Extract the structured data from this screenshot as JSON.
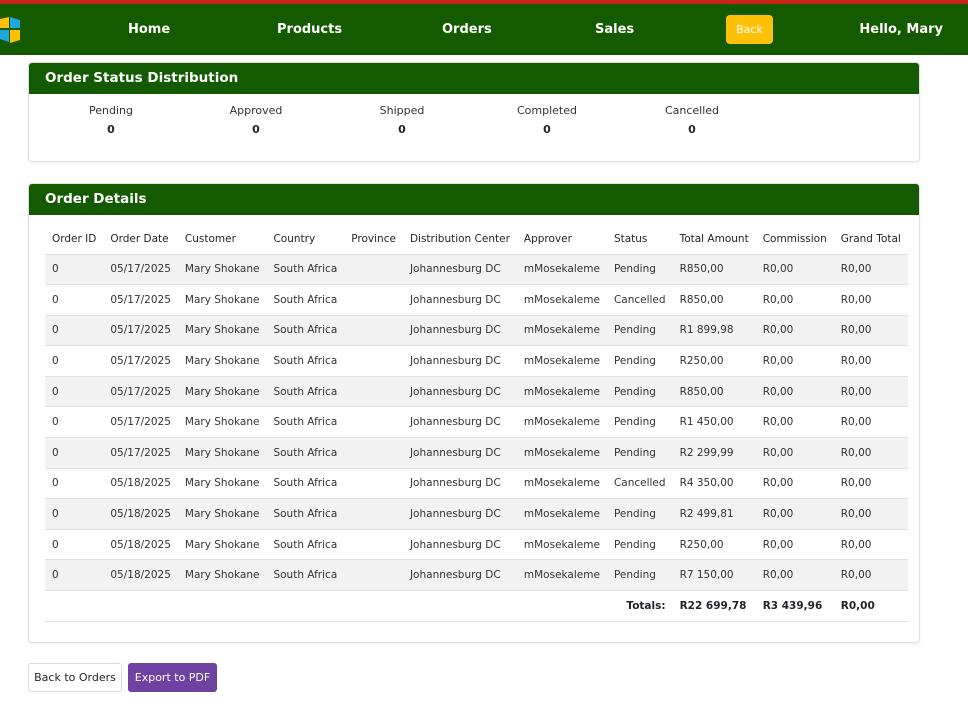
{
  "nav": {
    "home": "Home",
    "products": "Products",
    "orders": "Orders",
    "sales": "Sales",
    "back": "Back",
    "greeting": "Hello, Mary"
  },
  "status": {
    "title": "Order Status Distribution",
    "items": [
      {
        "label": "Pending",
        "count": "0"
      },
      {
        "label": "Approved",
        "count": "0"
      },
      {
        "label": "Shipped",
        "count": "0"
      },
      {
        "label": "Completed",
        "count": "0"
      },
      {
        "label": "Cancelled",
        "count": "0"
      }
    ]
  },
  "details": {
    "title": "Order Details",
    "columns": [
      "Order ID",
      "Order Date",
      "Customer",
      "Country",
      "Province",
      "Distribution Center",
      "Approver",
      "Status",
      "Total Amount",
      "Commission",
      "Grand Total"
    ],
    "rows": [
      [
        "0",
        "05/17/2025",
        "Mary Shokane",
        "South Africa",
        "",
        "Johannesburg DC",
        "mMosekaleme",
        "Pending",
        "R850,00",
        "R0,00",
        "R0,00"
      ],
      [
        "0",
        "05/17/2025",
        "Mary Shokane",
        "South Africa",
        "",
        "Johannesburg DC",
        "mMosekaleme",
        "Cancelled",
        "R850,00",
        "R0,00",
        "R0,00"
      ],
      [
        "0",
        "05/17/2025",
        "Mary Shokane",
        "South Africa",
        "",
        "Johannesburg DC",
        "mMosekaleme",
        "Pending",
        "R1 899,98",
        "R0,00",
        "R0,00"
      ],
      [
        "0",
        "05/17/2025",
        "Mary Shokane",
        "South Africa",
        "",
        "Johannesburg DC",
        "mMosekaleme",
        "Pending",
        "R250,00",
        "R0,00",
        "R0,00"
      ],
      [
        "0",
        "05/17/2025",
        "Mary Shokane",
        "South Africa",
        "",
        "Johannesburg DC",
        "mMosekaleme",
        "Pending",
        "R850,00",
        "R0,00",
        "R0,00"
      ],
      [
        "0",
        "05/17/2025",
        "Mary Shokane",
        "South Africa",
        "",
        "Johannesburg DC",
        "mMosekaleme",
        "Pending",
        "R1 450,00",
        "R0,00",
        "R0,00"
      ],
      [
        "0",
        "05/17/2025",
        "Mary Shokane",
        "South Africa",
        "",
        "Johannesburg DC",
        "mMosekaleme",
        "Pending",
        "R2 299,99",
        "R0,00",
        "R0,00"
      ],
      [
        "0",
        "05/18/2025",
        "Mary Shokane",
        "South Africa",
        "",
        "Johannesburg DC",
        "mMosekaleme",
        "Cancelled",
        "R4 350,00",
        "R0,00",
        "R0,00"
      ],
      [
        "0",
        "05/18/2025",
        "Mary Shokane",
        "South Africa",
        "",
        "Johannesburg DC",
        "mMosekaleme",
        "Pending",
        "R2 499,81",
        "R0,00",
        "R0,00"
      ],
      [
        "0",
        "05/18/2025",
        "Mary Shokane",
        "South Africa",
        "",
        "Johannesburg DC",
        "mMosekaleme",
        "Pending",
        "R250,00",
        "R0,00",
        "R0,00"
      ],
      [
        "0",
        "05/18/2025",
        "Mary Shokane",
        "South Africa",
        "",
        "Johannesburg DC",
        "mMosekaleme",
        "Pending",
        "R7 150,00",
        "R0,00",
        "R0,00"
      ]
    ],
    "totals": {
      "label": "Totals:",
      "total_amount": "R22 699,78",
      "commission": "R3 439,96",
      "grand_total": "R0,00"
    }
  },
  "actions": {
    "back_to_orders": "Back to Orders",
    "export_pdf": "Export to PDF"
  },
  "colors": {
    "navbar": "#145a00",
    "top_accent": "#c8221b",
    "back_button": "#ffc107",
    "export_button": "#6f42a1"
  }
}
